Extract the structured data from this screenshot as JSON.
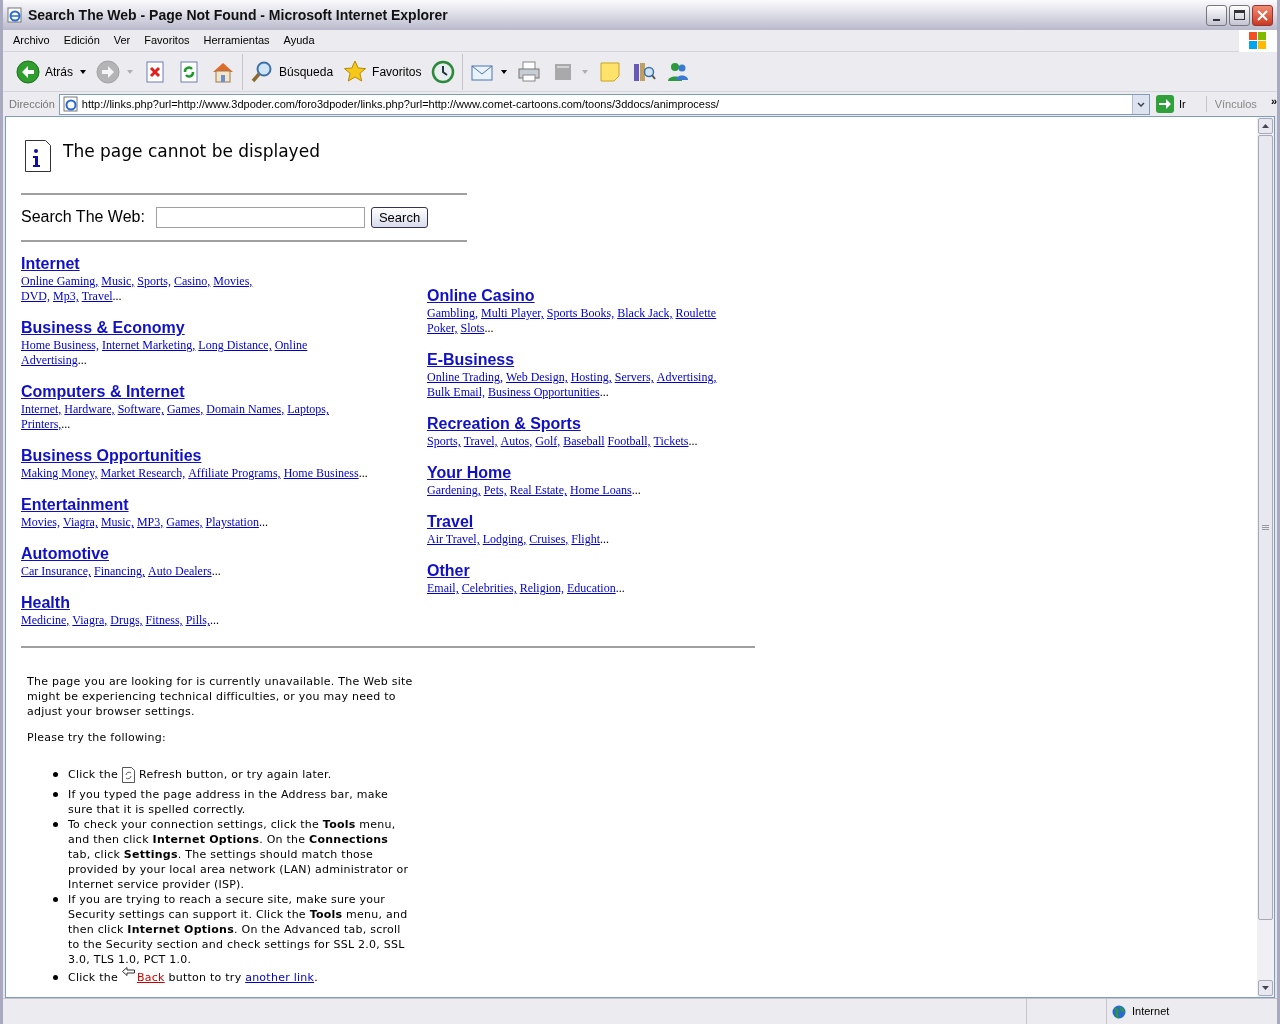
{
  "window": {
    "title": "Search The Web - Page Not Found - Microsoft Internet Explorer"
  },
  "menu": [
    "Archivo",
    "Edición",
    "Ver",
    "Favoritos",
    "Herramientas",
    "Ayuda"
  ],
  "toolbar": [
    [
      {
        "kind": "back",
        "label": "Atrás",
        "disabled": false,
        "dropdown": true
      },
      {
        "kind": "forward",
        "disabled": true,
        "dropdown": true
      },
      {
        "kind": "stop",
        "disabled": false,
        "dropdown": false
      },
      {
        "kind": "refresh",
        "disabled": false,
        "dropdown": false
      },
      {
        "kind": "home",
        "disabled": false,
        "dropdown": false
      }
    ],
    [
      {
        "kind": "search",
        "label": "Búsqueda",
        "disabled": false,
        "dropdown": false
      },
      {
        "kind": "favorites",
        "label": "Favoritos",
        "disabled": false,
        "dropdown": false
      },
      {
        "kind": "history",
        "disabled": false,
        "dropdown": false
      }
    ],
    [
      {
        "kind": "mail",
        "disabled": false,
        "dropdown": true
      },
      {
        "kind": "print",
        "disabled": false,
        "dropdown": false
      },
      {
        "kind": "edit",
        "disabled": true,
        "dropdown": true
      },
      {
        "kind": "notes",
        "disabled": false,
        "dropdown": false
      },
      {
        "kind": "research",
        "disabled": false,
        "dropdown": false
      },
      {
        "kind": "messenger",
        "disabled": false,
        "dropdown": false
      }
    ]
  ],
  "address": {
    "label": "Dirección",
    "url": "http://links.php?url=http://www.3dpoder.com/foro3dpoder/links.php?url=http://www.comet-cartoons.com/toons/3ddocs/animprocess/",
    "go": "Ir",
    "links": "Vínculos",
    "more": "»"
  },
  "page": {
    "title": "The page cannot be displayed",
    "search": {
      "label": "Search The Web:",
      "button": "Search"
    },
    "columns": [
      [
        {
          "title": "Internet",
          "lines": [
            [
              "Online Gaming,",
              "Music,",
              "Sports,",
              "Casino,",
              "Movies,"
            ],
            [
              "DVD,",
              "Mp3,",
              "Travel"
            ]
          ],
          "more": "..."
        },
        {
          "title": "Business & Economy",
          "lines": [
            [
              "Home Business,",
              "Internet Marketing,",
              "Long Distance,",
              "Online"
            ],
            [
              "Advertising"
            ]
          ],
          "more": "..."
        },
        {
          "title": "Computers & Internet",
          "lines": [
            [
              "Internet,",
              "Hardware,",
              "Software,",
              "Games,",
              "Domain Names,",
              "Laptops,"
            ],
            [
              "Printers,"
            ]
          ],
          "more": "..."
        },
        {
          "title": "Business Opportunities",
          "lines": [
            [
              "Making Money,",
              "Market Research,",
              "Affiliate Programs,",
              "Home Business"
            ]
          ],
          "more": "..."
        },
        {
          "title": "Entertainment",
          "lines": [
            [
              "Movies,",
              "Viagra,",
              "Music,",
              "MP3,",
              "Games,",
              "Playstation"
            ]
          ],
          "more": "..."
        },
        {
          "title": "Automotive",
          "lines": [
            [
              "Car Insurance,",
              "Financing,",
              "Auto Dealers"
            ]
          ],
          "more": "..."
        },
        {
          "title": "Health",
          "lines": [
            [
              "Medicine,",
              "Viagra,",
              "Drugs,",
              "Fitness,",
              "Pills,"
            ]
          ],
          "more": "..."
        }
      ],
      [
        {
          "title": "Online Casino",
          "lines": [
            [
              "Gambling,",
              "Multi Player,",
              "Sports Books,",
              "Black Jack,",
              "Roulette"
            ],
            [
              "Poker,",
              "Slots"
            ]
          ],
          "more": "..."
        },
        {
          "title": "E-Business",
          "lines": [
            [
              "Online Trading,",
              "Web Design,",
              "Hosting,",
              "Servers,",
              "Advertising,"
            ],
            [
              "Bulk Email,",
              "Business Opportunities"
            ]
          ],
          "more": "..."
        },
        {
          "title": "Recreation & Sports",
          "lines": [
            [
              "Sports,",
              "Travel,",
              "Autos,",
              "Golf,",
              "Baseball",
              "Football,",
              "Tickets"
            ]
          ],
          "more": "..."
        },
        {
          "title": "Your Home",
          "lines": [
            [
              "Gardening,",
              "Pets,",
              "Real Estate,",
              "Home Loans"
            ]
          ],
          "more": "..."
        },
        {
          "title": "Travel",
          "lines": [
            [
              "Air Travel,",
              "Lodging,",
              "Cruises,",
              "Flight"
            ]
          ],
          "more": "..."
        },
        {
          "title": "Other",
          "lines": [
            [
              "Email,",
              "Celebrities,",
              "Religion,",
              "Education"
            ]
          ],
          "more": "..."
        }
      ]
    ],
    "message": {
      "paragraphs": [
        "The page you are looking for is currently unavailable. The Web site might be experiencing technical difficulties, or you may need to adjust your browser settings.",
        "Please try the following:"
      ],
      "items": [
        {
          "kind": "refresh",
          "before": "Click the",
          "text": "Refresh button, or try again later."
        },
        {
          "kind": "text",
          "text": "If you typed the page address in the Address bar, make sure that it is spelled correctly."
        },
        {
          "kind": "text",
          "text": "To check your connection settings, click the **Tools** menu, and then click **Internet Options**. On the **Connections** tab, click **Settings**. The settings should match those provided by your local area network (LAN) administrator or Internet service provider (ISP)."
        },
        {
          "kind": "text",
          "text": "If you are trying to reach a secure site, make sure your Security settings can support it. Click the **Tools** menu, and then click **Internet Options**. On the Advanced tab, scroll to the Security section and check settings for SSL 2.0, SSL 3.0, TLS 1.0, PCT 1.0."
        },
        {
          "kind": "back",
          "before": "Click the",
          "link": "Back",
          "middle": "button to try",
          "link2": "another link",
          "end": "."
        }
      ]
    }
  },
  "status": {
    "zone": "Internet"
  }
}
